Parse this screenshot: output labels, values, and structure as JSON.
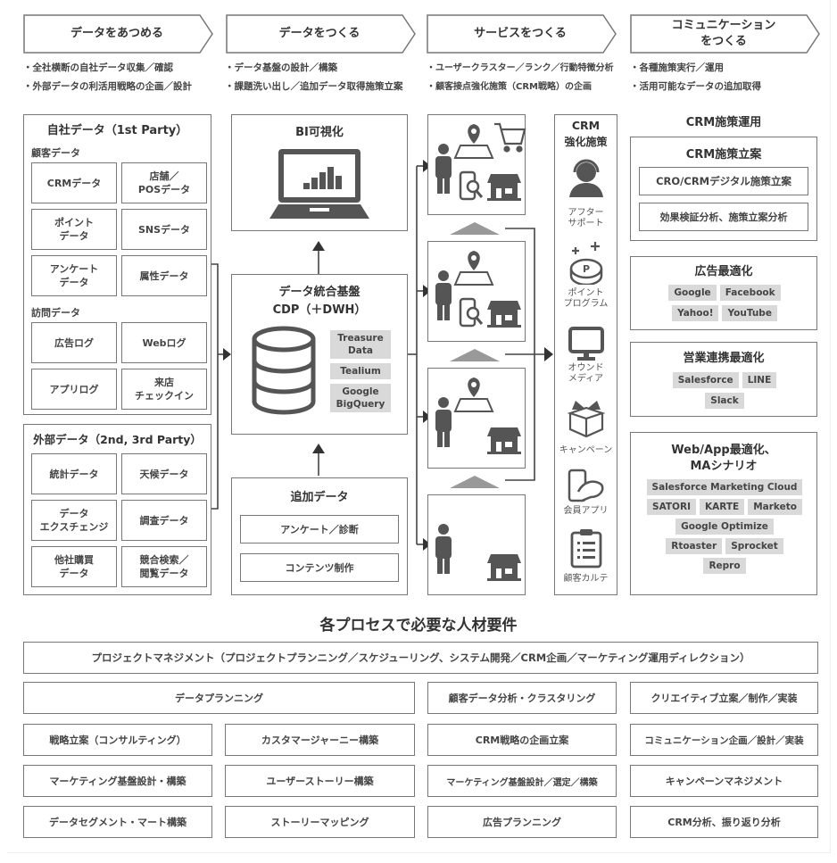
{
  "steps": [
    {
      "label": "データをあつめる",
      "bullets": [
        "・全社横断の自社データ収集／確認",
        "・外部データの利活用戦略の企画／設計"
      ]
    },
    {
      "label": "データをつくる",
      "bullets": [
        "・データ基盤の設計／構築",
        "・課題洗い出し／追加データ取得施策立案"
      ]
    },
    {
      "label": "サービスをつくる",
      "bullets": [
        "・ユーザークラスター／ランク／行動特徴分析",
        "・顧客接点強化施策（CRM戦略）の企画"
      ]
    },
    {
      "label": "コミュニケーション\nをつくる",
      "label_line1": "コミュニケーション",
      "label_line2": "をつくる",
      "bullets": [
        "・各種施策実行／運用",
        "・活用可能なデータの追加取得"
      ]
    }
  ],
  "first_party": {
    "title": "自社データ（1st Party）",
    "customer_label": "顧客データ",
    "customer_items": [
      "CRMデータ",
      "店舗／\nPOSデータ",
      "ポイント\nデータ",
      "SNSデータ",
      "アンケート\nデータ",
      "属性データ"
    ],
    "visit_label": "訪問データ",
    "visit_items": [
      "広告ログ",
      "Webログ",
      "アプリログ",
      "来店\nチェックイン"
    ]
  },
  "external": {
    "title": "外部データ（2nd, 3rd Party）",
    "items": [
      "統計データ",
      "天候データ",
      "データ\nエクスチェンジ",
      "調査データ",
      "他社購買\nデータ",
      "競合検索／\n閲覧データ"
    ]
  },
  "bi": {
    "title": "BI可視化",
    "icon": "laptop-chart-icon"
  },
  "cdp": {
    "title_line1": "データ統合基盤",
    "title_line2": "CDP（＋DWH）",
    "icon": "database-icon",
    "tools": [
      "Treasure\nData",
      "Tealium",
      "Google\nBigQuery"
    ]
  },
  "additional": {
    "title": "追加データ",
    "items": [
      "アンケート／診断",
      "コンテンツ制作"
    ]
  },
  "service_stages": [
    {
      "icons": [
        "person-icon",
        "map-pin-icon",
        "cart-icon",
        "phone-search-icon",
        "store-icon"
      ]
    },
    {
      "icons": [
        "person-icon",
        "map-pin-icon",
        "phone-search-icon",
        "store-icon"
      ]
    },
    {
      "icons": [
        "person-icon",
        "map-pin-icon",
        "store-icon"
      ]
    },
    {
      "icons": [
        "person-icon",
        "store-icon"
      ]
    }
  ],
  "crm": {
    "title_line1": "CRM",
    "title_line2": "強化施策",
    "items": [
      {
        "icon": "headset-icon",
        "label": "アフター\nサポート"
      },
      {
        "icon": "point-coin-icon",
        "label": "ポイント\nプログラム"
      },
      {
        "icon": "monitor-icon",
        "label": "オウンド\nメディア"
      },
      {
        "icon": "gift-icon",
        "label": "キャンペーン"
      },
      {
        "icon": "member-app-icon",
        "label": "会員アプリ"
      },
      {
        "icon": "clipboard-icon",
        "label": "顧客カルテ"
      }
    ]
  },
  "operations": {
    "title": "CRM施策運用",
    "planning": {
      "title": "CRM施策立案",
      "items": [
        "CRO/CRMデジタル施策立案",
        "効果検証分析、施策立案分析"
      ]
    },
    "ads": {
      "title": "広告最適化",
      "tags": [
        "Google",
        "Facebook",
        "Yahoo!",
        "YouTube"
      ]
    },
    "sales": {
      "title": "営業連携最適化",
      "tags": [
        "Salesforce",
        "LINE",
        "Slack"
      ]
    },
    "web": {
      "title_line1": "Web/App最適化、",
      "title_line2": "MAシナリオ",
      "tags": [
        "Salesforce Marketing Cloud",
        "SATORI",
        "KARTE",
        "Marketo",
        "Google Optimize",
        "Rtoaster",
        "Sprocket",
        "Repro"
      ]
    }
  },
  "requirements": {
    "title": "各プロセスで必要な人材要件",
    "project_management": "プロジェクトマネジメント（プロジェクトプランニング／スケジューリング、システム開発／CRM企画／マーケティング運用ディレクション）",
    "row2": [
      "データプランニング",
      "顧客データ分析・クラスタリング",
      "クリエイティブ立案／制作／実装"
    ],
    "grid": [
      [
        "戦略立案（コンサルティング）",
        "カスタマージャーニー構築",
        "CRM戦略の企画立案",
        "コミュニケーション企画／設計／実装"
      ],
      [
        "マーケティング基盤設計・構築",
        "ユーザーストーリー構築",
        "マーケティング基盤設計／選定／構築",
        "キャンペーンマネジメント"
      ],
      [
        "データセグメント・マート構築",
        "ストーリーマッピング",
        "広告プランニング",
        "CRM分析、振り返り分析"
      ]
    ]
  }
}
